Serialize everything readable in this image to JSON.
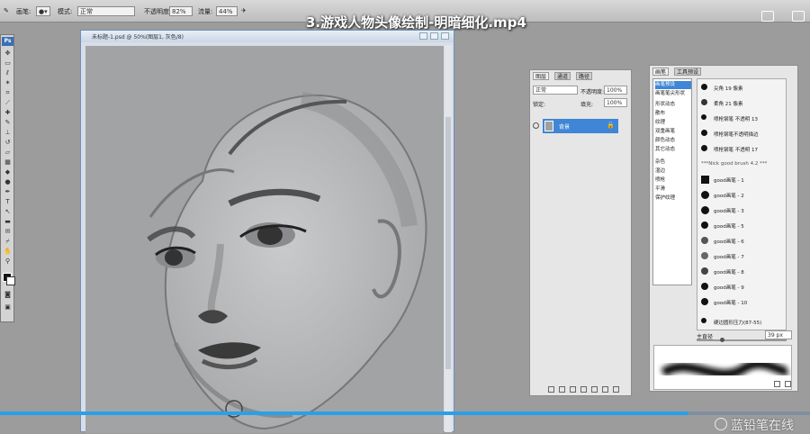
{
  "options_bar": {
    "brush_label": "画笔:",
    "mode_label": "模式:",
    "mode_value": "正常",
    "opacity_label": "不透明度:",
    "opacity_value": "82%",
    "flow_label": "流量:",
    "flow_value": "44%"
  },
  "video_title": "3.游戏人物头像绘制-明暗细化.mp4",
  "document": {
    "title": "未标题-1.psd @ 50%(图层1, 灰色/8)"
  },
  "toolbox": {
    "logo": "Ps"
  },
  "layers_panel": {
    "tabs": [
      "图层",
      "通道",
      "路径"
    ],
    "blend_mode": "正常",
    "opacity_label": "不透明度:",
    "opacity_value": "100%",
    "lock_label": "锁定:",
    "fill_label": "填充:",
    "fill_value": "100%",
    "layers": [
      {
        "name": "背景",
        "selected": true
      }
    ]
  },
  "brushes_panel": {
    "tabs": [
      "画笔",
      "工具预设"
    ],
    "settings": [
      "画笔预设",
      "画笔笔尖形状",
      "形状动态",
      "散布",
      "纹理",
      "双重画笔",
      "颜色动态",
      "其它动态",
      "杂色",
      "湿边",
      "喷枪",
      "平滑",
      "保护纹理"
    ],
    "presets": [
      "尖角 19 像素",
      "柔角 21 像素",
      "喷枪钢笔 不透明 13",
      "喷枪钢笔不透明描边",
      "喷枪钢笔 不透明 17",
      "***Nick good brush 4.2 ***",
      "good画笔 - 1",
      "good画笔 - 2",
      "good画笔 - 3",
      "good画笔 - 5",
      "good画笔 - 6",
      "good画笔 - 7",
      "good画笔 - 8",
      "good画笔 - 9",
      "good画笔 - 10",
      "硬边圆形压力(87-55)"
    ],
    "diameter_label": "主直径",
    "diameter_value": "39 px"
  },
  "progress": {
    "fraction": 0.85
  },
  "watermark": "蓝铅笔在线"
}
